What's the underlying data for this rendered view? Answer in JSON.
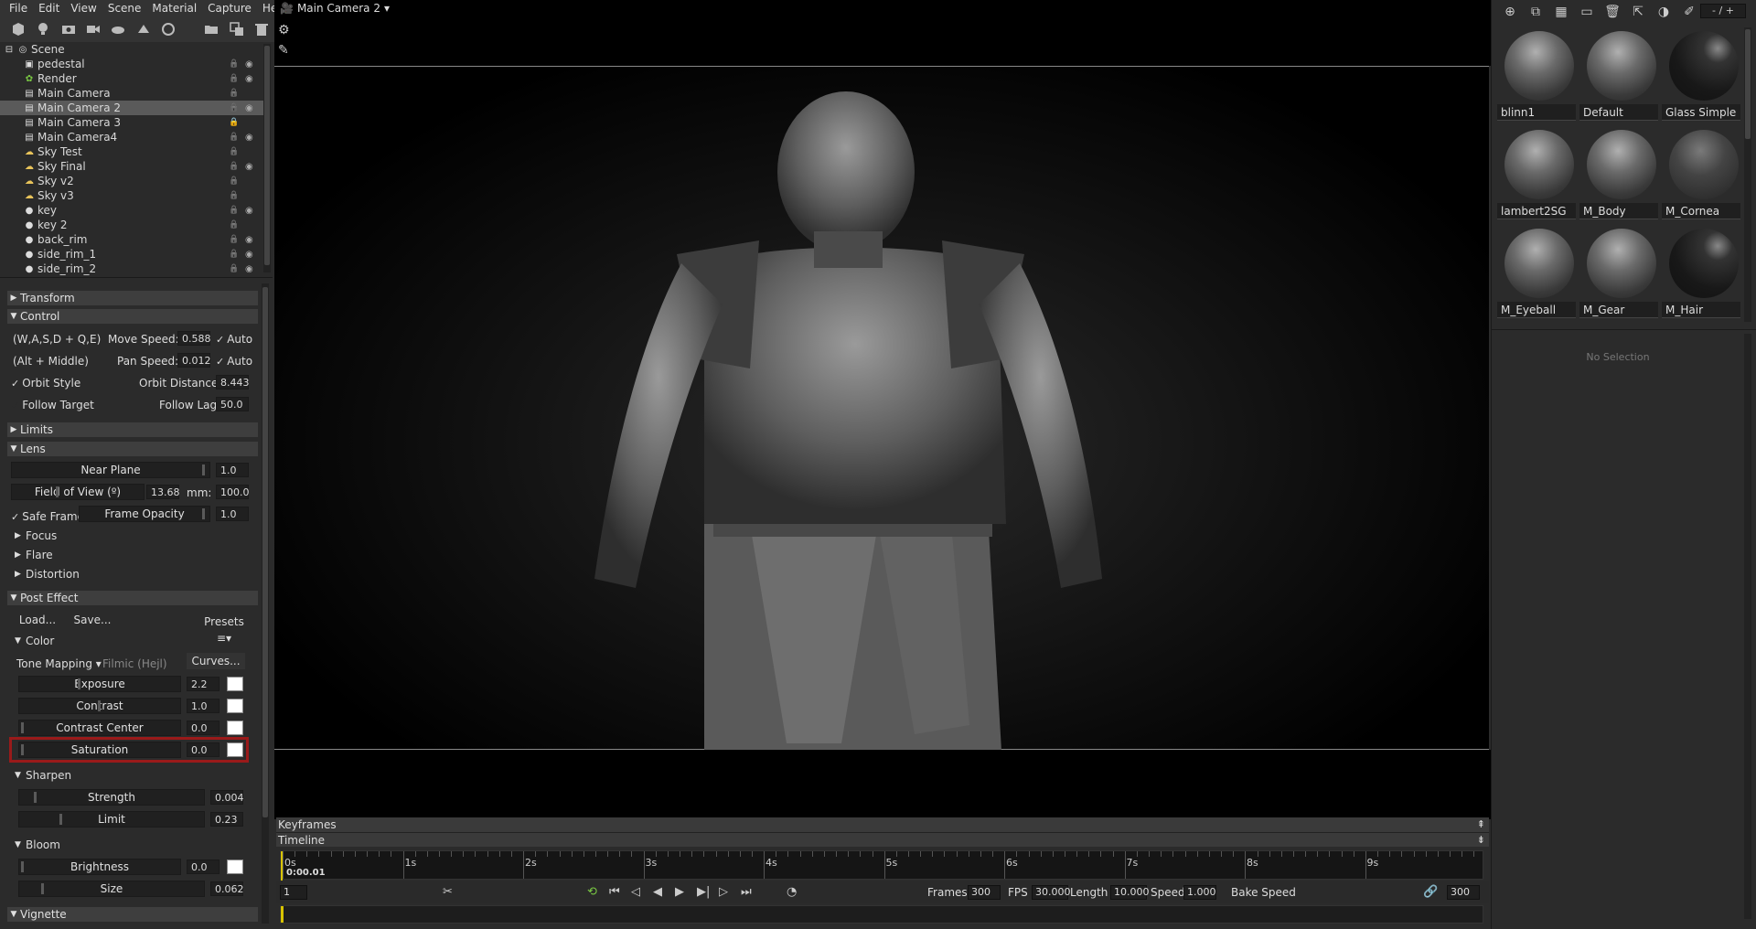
{
  "menu": [
    "File",
    "Edit",
    "View",
    "Scene",
    "Material",
    "Capture",
    "Help"
  ],
  "scene_tree": {
    "root": "Scene",
    "items": [
      {
        "label": "pedestal",
        "icon": "mesh-icon",
        "eye": true,
        "locked": false,
        "selected": false
      },
      {
        "label": "Render",
        "icon": "render-icon",
        "eye": true,
        "locked": false,
        "selected": false
      },
      {
        "label": "Main Camera",
        "icon": "camera-icon",
        "eye": false,
        "locked": false,
        "selected": false
      },
      {
        "label": "Main Camera 2",
        "icon": "camera-icon",
        "eye": true,
        "locked": false,
        "selected": true
      },
      {
        "label": "Main Camera 3",
        "icon": "camera-icon",
        "eye": false,
        "locked": true,
        "selected": false
      },
      {
        "label": "Main Camera4",
        "icon": "camera-icon",
        "eye": true,
        "locked": false,
        "selected": false
      },
      {
        "label": "Sky Test",
        "icon": "sky-icon",
        "eye": false,
        "locked": false,
        "selected": false
      },
      {
        "label": "Sky Final",
        "icon": "sky-icon",
        "eye": true,
        "locked": false,
        "selected": false
      },
      {
        "label": "Sky v2",
        "icon": "sky-icon",
        "eye": false,
        "locked": false,
        "selected": false
      },
      {
        "label": "Sky v3",
        "icon": "sky-icon",
        "eye": false,
        "locked": false,
        "selected": false
      },
      {
        "label": "key",
        "icon": "light-icon",
        "eye": true,
        "locked": false,
        "selected": false
      },
      {
        "label": "key 2",
        "icon": "light-icon",
        "eye": false,
        "locked": false,
        "selected": false
      },
      {
        "label": "back_rim",
        "icon": "light-icon",
        "eye": true,
        "locked": false,
        "selected": false
      },
      {
        "label": "side_rim_1",
        "icon": "light-icon",
        "eye": true,
        "locked": false,
        "selected": false
      },
      {
        "label": "side_rim_2",
        "icon": "light-icon",
        "eye": true,
        "locked": false,
        "selected": false
      }
    ]
  },
  "props": {
    "transform": "Transform",
    "control": "Control",
    "wasd": "(W,A,S,D + Q,E)",
    "move_speed_label": "Move Speed:",
    "move_speed": "0.588",
    "auto": "Auto",
    "alt_middle": "(Alt + Middle)",
    "pan_speed_label": "Pan Speed:",
    "pan_speed": "0.012",
    "orbit_style": "Orbit Style",
    "orbit_distance_label": "Orbit Distance:",
    "orbit_distance": "8.443",
    "follow_target": "Follow Target",
    "follow_lag_label": "Follow Lag",
    "follow_lag": "50.0",
    "limits": "Limits",
    "lens": "Lens",
    "near_plane": "Near Plane",
    "near_plane_val": "1.0",
    "fov": "Field of View (º)",
    "fov_val": "13.68",
    "mm_label": "mm:",
    "mm_val": "100.0",
    "safe_frame": "Safe Frame",
    "frame_opacity": "Frame Opacity",
    "frame_opacity_val": "1.0",
    "focus": "Focus",
    "flare": "Flare",
    "distortion": "Distortion",
    "post_effect": "Post Effect",
    "load": "Load...",
    "save": "Save...",
    "presets": "Presets",
    "color": "Color",
    "tone_mapping": "Tone Mapping",
    "tone_mode": "Filmic (Hejl)",
    "curves": "Curves...",
    "exposure": "Exposure",
    "exposure_val": "2.2",
    "contrast": "Contrast",
    "contrast_val": "1.0",
    "contrast_center": "Contrast Center",
    "contrast_center_val": "0.0",
    "saturation": "Saturation",
    "saturation_val": "0.0",
    "sharpen": "Sharpen",
    "strength": "Strength",
    "strength_val": "0.004",
    "limit": "Limit",
    "limit_val": "0.23",
    "bloom": "Bloom",
    "brightness": "Brightness",
    "brightness_val": "0.0",
    "size": "Size",
    "size_val": "0.062",
    "vignette": "Vignette"
  },
  "viewport": {
    "camera": "Main Camera 2"
  },
  "timeline": {
    "keyframes": "Keyframes",
    "timeline": "Timeline",
    "ticks": [
      "0s",
      "1s",
      "2s",
      "3s",
      "4s",
      "5s",
      "6s",
      "7s",
      "8s",
      "9s"
    ],
    "current_time": "0:00.01",
    "current_frame": "1",
    "frames_label": "Frames",
    "frames": "300",
    "fps_label": "FPS",
    "fps": "30.000",
    "length_label": "Length",
    "length": "10.000",
    "speed_label": "Speed",
    "speed": "1.000",
    "bake_speed": "Bake Speed",
    "end_frame": "300"
  },
  "materials": {
    "page": "- / +",
    "items": [
      "blinn1",
      "Default",
      "Glass Simple",
      "lambert2SG",
      "M_Body",
      "M_Cornea",
      "M_Eyeball",
      "M_Gear",
      "M_Hair"
    ],
    "no_selection": "No Selection"
  },
  "colors": {
    "highlight": "#9a1a1a",
    "playhead": "#d8c300",
    "selected_row": "#5a5a5a"
  }
}
